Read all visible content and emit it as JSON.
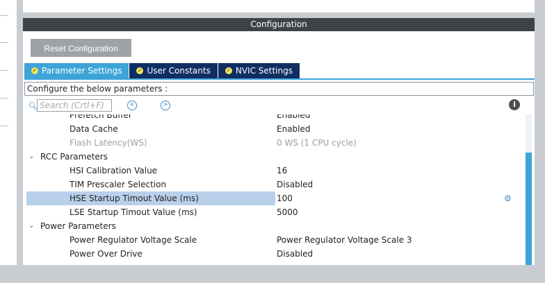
{
  "config": {
    "title": "Configuration",
    "reset_label": "Reset Configuration",
    "description": "Configure the below parameters :"
  },
  "tabs": [
    {
      "label": "Parameter Settings",
      "active": true
    },
    {
      "label": "User Constants",
      "active": false
    },
    {
      "label": "NVIC Settings",
      "active": false
    }
  ],
  "search": {
    "placeholder": "Search (Crtl+F)"
  },
  "rows": [
    {
      "type": "item",
      "name": "Prefetch Buffer",
      "value": "Enabled",
      "disabled": false
    },
    {
      "type": "item",
      "name": "Data Cache",
      "value": "Enabled",
      "disabled": false
    },
    {
      "type": "item",
      "name": "Flash Latency(WS)",
      "value": "0 WS (1 CPU cycle)",
      "disabled": true
    },
    {
      "type": "group",
      "name": "RCC Parameters"
    },
    {
      "type": "item",
      "name": "HSI Calibration Value",
      "value": "16",
      "disabled": false
    },
    {
      "type": "item",
      "name": "TIM Prescaler Selection",
      "value": "Disabled",
      "disabled": false
    },
    {
      "type": "item",
      "name": "HSE Startup Timout Value (ms)",
      "value": "100",
      "disabled": false,
      "selected": true
    },
    {
      "type": "item",
      "name": "LSE Startup Timout Value (ms)",
      "value": "5000",
      "disabled": false
    },
    {
      "type": "group",
      "name": "Power Parameters"
    },
    {
      "type": "item",
      "name": "Power Regulator Voltage Scale",
      "value": "Power Regulator Voltage Scale 3",
      "disabled": false
    },
    {
      "type": "item",
      "name": "Power Over Drive",
      "value": "Disabled",
      "disabled": false
    }
  ],
  "colors": {
    "tab_active": "#3ca4d8",
    "tab_inactive": "#0f2e63",
    "header_bg": "#3e4347",
    "selection": "#b9d0ea"
  }
}
